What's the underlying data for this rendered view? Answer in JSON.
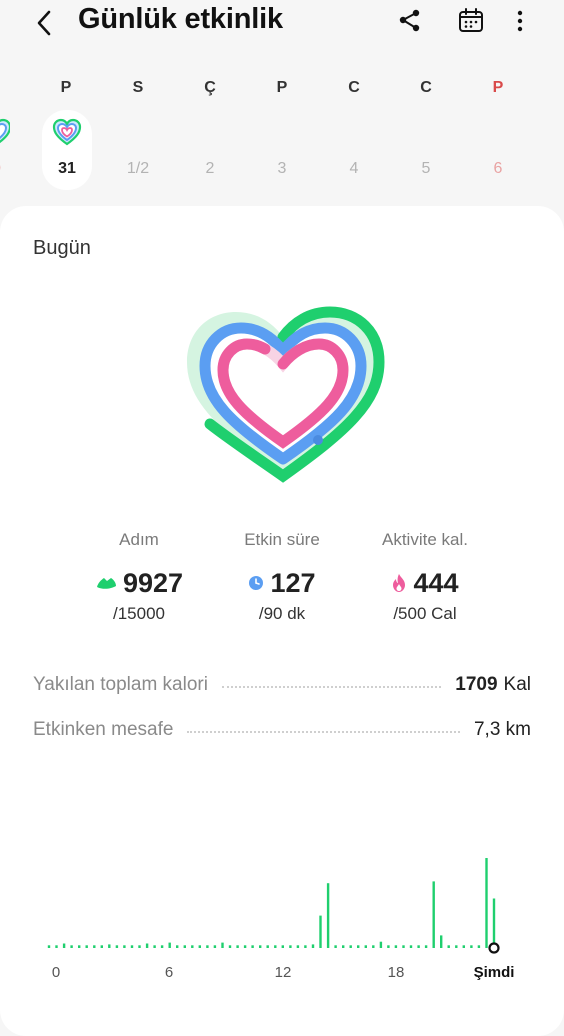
{
  "header": {
    "title": "Günlük etkinlik",
    "icons": [
      "back-icon",
      "share-icon",
      "calendar-icon",
      "more-options-icon"
    ]
  },
  "week": {
    "days": [
      {
        "letter": "P",
        "number": "31",
        "today": true
      },
      {
        "letter": "S",
        "number": "1/2"
      },
      {
        "letter": "Ç",
        "number": "2"
      },
      {
        "letter": "P",
        "number": "3"
      },
      {
        "letter": "C",
        "number": "4"
      },
      {
        "letter": "C",
        "number": "5"
      },
      {
        "letter": "P",
        "number": "6",
        "sunday": true
      }
    ]
  },
  "summary": {
    "section_title": "Bugün",
    "ring_colors": {
      "steps": "#1fcf6e",
      "active_time": "#5b9ef2",
      "calories": "#ee5d9d"
    },
    "stats": [
      {
        "label": "Adım",
        "value": "9927",
        "goal": "/15000",
        "icon": "shoe-icon",
        "progress": 0.662
      },
      {
        "label": "Etkin süre",
        "value": "127",
        "goal": "/90 dk",
        "icon": "clock-icon",
        "progress": 1.0
      },
      {
        "label": "Aktivite kal.",
        "value": "444",
        "goal": "/500 Cal",
        "icon": "flame-icon",
        "progress": 0.888
      }
    ]
  },
  "details": {
    "total_calories_label": "Yakılan toplam kalori",
    "total_calories_value": "1709",
    "total_calories_unit": "Kal",
    "distance_label": "Etkinken mesafe",
    "distance_value": "7,3 km"
  },
  "timeline": {
    "ticks": [
      "0",
      "6",
      "12",
      "18",
      "Şimdi"
    ],
    "bar_color": "#1fcf6e",
    "activity_levels": [
      0.03,
      0.03,
      0.05,
      0.03,
      0.03,
      0.03,
      0.03,
      0.03,
      0.04,
      0.03,
      0.03,
      0.03,
      0.03,
      0.05,
      0.03,
      0.03,
      0.06,
      0.03,
      0.03,
      0.03,
      0.03,
      0.03,
      0.03,
      0.06,
      0.03,
      0.03,
      0.03,
      0.03,
      0.03,
      0.03,
      0.03,
      0.03,
      0.03,
      0.03,
      0.03,
      0.04,
      0.36,
      0.72,
      0.03,
      0.03,
      0.03,
      0.03,
      0.03,
      0.03,
      0.07,
      0.03,
      0.03,
      0.03,
      0.03,
      0.03,
      0.03,
      0.74,
      0.14,
      0.03,
      0.03,
      0.03,
      0.03,
      0.03,
      1.0,
      0.55
    ]
  }
}
